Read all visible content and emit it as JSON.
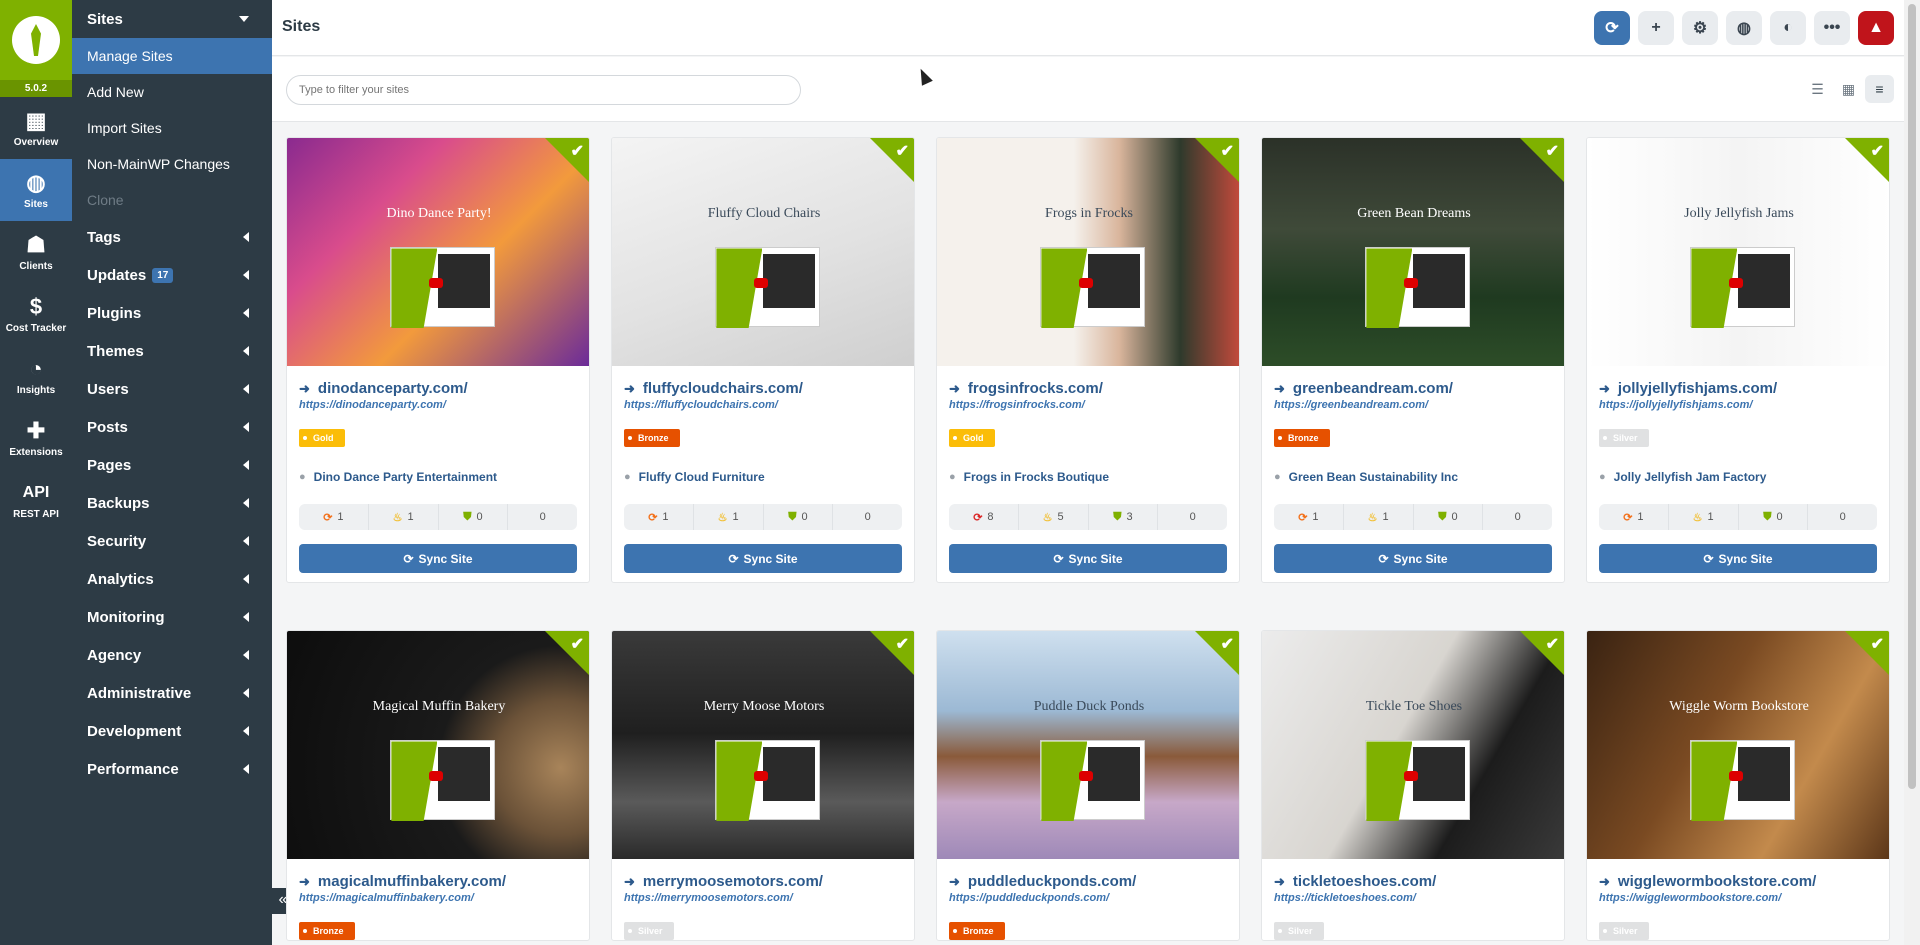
{
  "rail": {
    "version": "5.0.2",
    "items": [
      {
        "label": "Overview",
        "icon": "grid-icon",
        "glyph": "▦"
      },
      {
        "label": "Sites",
        "icon": "globe-icon",
        "glyph": "◍"
      },
      {
        "label": "Clients",
        "icon": "users-icon",
        "glyph": "☗"
      },
      {
        "label": "Cost Tracker",
        "icon": "dollar-icon",
        "glyph": "$"
      },
      {
        "label": "Insights",
        "icon": "pie-chart-icon",
        "glyph": "◔"
      },
      {
        "label": "Extensions",
        "icon": "puzzle-icon",
        "glyph": "✚"
      },
      {
        "label": "REST API",
        "icon": "api-icon",
        "glyph": "API"
      }
    ]
  },
  "menu": {
    "head": "Sites",
    "subitems": [
      "Manage Sites",
      "Add New",
      "Import Sites",
      "Non-MainWP Changes",
      "Clone"
    ],
    "sections": [
      "Tags",
      "Updates",
      "Plugins",
      "Themes",
      "Users",
      "Posts",
      "Pages",
      "Backups",
      "Security",
      "Analytics",
      "Monitoring",
      "Agency",
      "Administrative",
      "Development",
      "Performance"
    ],
    "updates_badge": "17"
  },
  "topbar": {
    "title": "Sites",
    "buttons": [
      "sync-icon",
      "plus-icon",
      "gear-icon",
      "globe-icon",
      "palette-icon",
      "more-icon",
      "alert-icon"
    ]
  },
  "filter": {
    "placeholder": "Type to filter your sites"
  },
  "colors": {
    "accent": "#3d74b0",
    "brand": "#7fb100",
    "sidebar": "#2d3b45",
    "alert": "#c0141b",
    "gold": "#fbbd08",
    "bronze": "#e65100",
    "silver": "#e0e1e2"
  },
  "sync_label": "Sync Site",
  "sites": [
    {
      "name": "dinodanceparty.com/",
      "url": "https://dinodanceparty.com/",
      "tier": "Gold",
      "tier_class": "gold",
      "client": "Dino Dance Party Entertainment",
      "stats": [
        "1",
        "1",
        "0",
        "0"
      ],
      "bg": "linear-gradient(135deg,#8a2a8f 0%,#d94c8c 30%,#f29a3c 60%,#6a2a9a 100%)",
      "site_text": "Dino Dance Party!"
    },
    {
      "name": "fluffycloudchairs.com/",
      "url": "https://fluffycloudchairs.com/",
      "tier": "Bronze",
      "tier_class": "bronze",
      "client": "Fluffy Cloud Furniture",
      "stats": [
        "1",
        "1",
        "0",
        "0"
      ],
      "bg": "linear-gradient(160deg,#f4f4f4 0%,#e2e2e2 55%,#cfcfcf 100%)",
      "site_text": "Fluffy Cloud Chairs"
    },
    {
      "name": "frogsinfrocks.com/",
      "url": "https://frogsinfrocks.com/",
      "tier": "Gold",
      "tier_class": "gold",
      "client": "Frogs in Frocks Boutique",
      "stats": [
        "8",
        "5",
        "3",
        "0"
      ],
      "bg": "linear-gradient(90deg,#f5f1ec 0%,#f5f1ec 45%,#d9b59c 60%,#2e3a2c 80%,#c64a3c 100%)",
      "site_text": "Frogs in Frocks"
    },
    {
      "name": "greenbeandream.com/",
      "url": "https://greenbeandream.com/",
      "tier": "Bronze",
      "tier_class": "bronze",
      "client": "Green Bean Sustainability Inc",
      "stats": [
        "1",
        "1",
        "0",
        "0"
      ],
      "bg": "linear-gradient(180deg,#2b3128 0%,#3f4a39 40%,#1f3a20 70%,#2d4d28 100%)",
      "site_text": "Green Bean Dreams"
    },
    {
      "name": "jollyjellyfishjams.com/",
      "url": "https://jollyjellyfishjams.com/",
      "tier": "Silver",
      "tier_class": "silver",
      "client": "Jolly Jellyfish Jam Factory",
      "stats": [
        "1",
        "1",
        "0",
        "0"
      ],
      "bg": "linear-gradient(90deg,#ffffff 0%,#f4f4f4 50%,#ffffff 100%)",
      "site_text": "Jolly Jellyfish Jams"
    },
    {
      "name": "magicalmuffinbakery.com/",
      "url": "https://magicalmuffinbakery.com/",
      "tier": "Bronze",
      "tier_class": "bronze",
      "client": "",
      "stats": [],
      "bg": "radial-gradient(circle at 90% 60%,#a8845a 0%,#6b5238 22%,#1a1a1a 40%,#0d0d0d 100%)",
      "site_text": "Magical Muffin Bakery"
    },
    {
      "name": "merrymoosemotors.com/",
      "url": "https://merrymoosemotors.com/",
      "tier": "Silver",
      "tier_class": "silver",
      "client": "",
      "stats": [],
      "bg": "linear-gradient(180deg,#3a3a3a 0%,#1f1f1f 45%,#5a5a5a 75%,#2a2a2a 100%)",
      "site_text": "Merry Moose Motors"
    },
    {
      "name": "puddleduckponds.com/",
      "url": "https://puddleduckponds.com/",
      "tier": "Bronze",
      "tier_class": "bronze",
      "client": "",
      "stats": [],
      "bg": "linear-gradient(180deg,#cfe0ef 0%,#9cb9d4 35%,#8a5a3a 55%,#c7a8c8 75%,#9e89b8 100%)",
      "site_text": "Puddle Duck Ponds"
    },
    {
      "name": "tickletoeshoes.com/",
      "url": "https://tickletoeshoes.com/",
      "tier": "Silver",
      "tier_class": "silver",
      "client": "",
      "stats": [],
      "bg": "linear-gradient(120deg,#ececec 0%,#d8d5d0 45%,#1c1c1c 70%,#3a3a3a 100%)",
      "site_text": "Tickle Toe Shoes"
    },
    {
      "name": "wigglewormbookstore.com/",
      "url": "https://wigglewormbookstore.com/",
      "tier": "Silver",
      "tier_class": "silver",
      "client": "",
      "stats": [],
      "bg": "linear-gradient(120deg,#3a2312 0%,#7a4a22 40%,#c38a4c 70%,#5a3518 100%)",
      "site_text": "Wiggle Worm Bookstore"
    }
  ]
}
